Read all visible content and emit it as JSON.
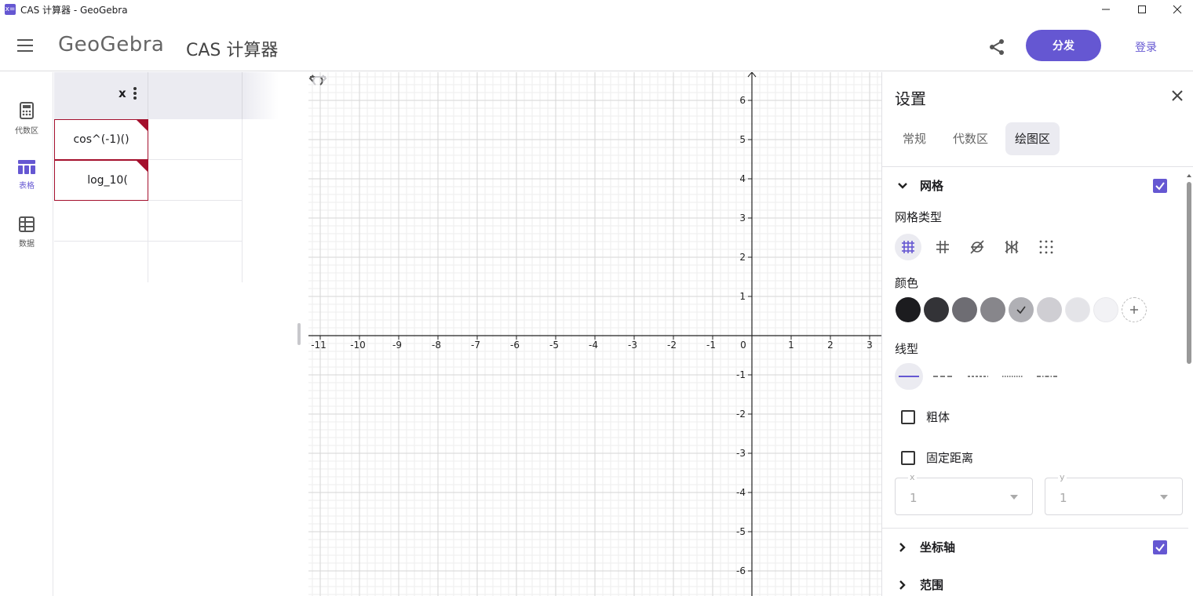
{
  "window": {
    "title": "CAS 计算器 - GeoGebra",
    "icon_text": "x=",
    "controls": [
      "minimize",
      "maximize",
      "close"
    ]
  },
  "header": {
    "logo": "GeoGebra",
    "app_name": "CAS 计算器",
    "share_label": "分发",
    "login_label": "登录"
  },
  "sidebar": {
    "items": [
      {
        "label": "代数区",
        "icon": "calculator-icon"
      },
      {
        "label": "表格",
        "icon": "table-icon",
        "active": true
      },
      {
        "label": "数据",
        "icon": "data-icon"
      }
    ]
  },
  "spreadsheet": {
    "column_header": "x",
    "cells": [
      "cos^(-1)()",
      "log_10("
    ]
  },
  "graph": {
    "x_ticks": [
      "-11",
      "-10",
      "-9",
      "-8",
      "-7",
      "-6",
      "-5",
      "-4",
      "-3",
      "-2",
      "-1",
      "0",
      "1",
      "2",
      "3"
    ],
    "y_ticks": [
      "6",
      "5",
      "4",
      "3",
      "2",
      "1",
      "-1",
      "-2",
      "-3",
      "-4",
      "-5",
      "-6"
    ]
  },
  "settings": {
    "title": "设置",
    "tabs": [
      "常规",
      "代数区",
      "绘图区"
    ],
    "active_tab": "绘图区",
    "grid_section": "网格",
    "grid_type_label": "网格类型",
    "color_label": "颜色",
    "line_style_label": "线型",
    "bold_label": "粗体",
    "fixed_distance_label": "固定距离",
    "x_select": {
      "label": "x",
      "value": "1"
    },
    "y_select": {
      "label": "y",
      "value": "1"
    },
    "axes_section": "坐标轴",
    "range_section": "范围",
    "swatches": [
      "#1c1c1f",
      "#333337",
      "#6e6d73",
      "#87868b",
      "#b0b0b5",
      "#cfced3",
      "#e4e4e8",
      "#f2f2f5"
    ],
    "accent": "#6557d2"
  }
}
